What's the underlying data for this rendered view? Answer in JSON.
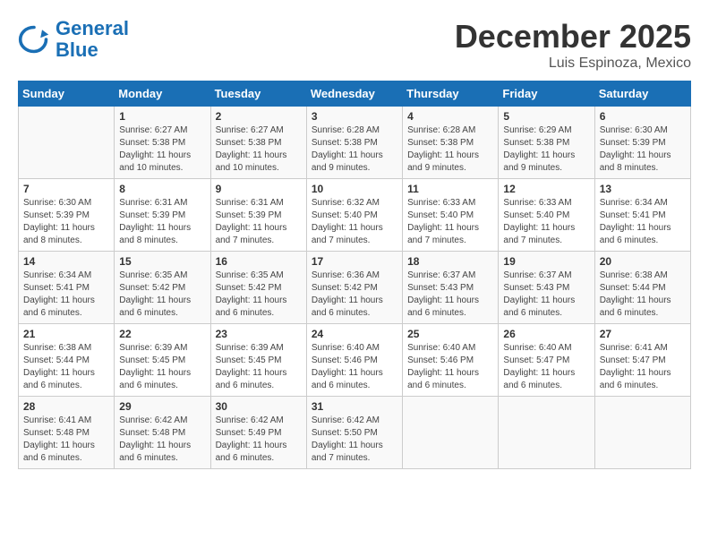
{
  "header": {
    "logo_line1": "General",
    "logo_line2": "Blue",
    "title": "December 2025",
    "subtitle": "Luis Espinoza, Mexico"
  },
  "columns": [
    "Sunday",
    "Monday",
    "Tuesday",
    "Wednesday",
    "Thursday",
    "Friday",
    "Saturday"
  ],
  "weeks": [
    [
      {
        "day": "",
        "text": ""
      },
      {
        "day": "1",
        "text": "Sunrise: 6:27 AM\nSunset: 5:38 PM\nDaylight: 11 hours and 10 minutes."
      },
      {
        "day": "2",
        "text": "Sunrise: 6:27 AM\nSunset: 5:38 PM\nDaylight: 11 hours and 10 minutes."
      },
      {
        "day": "3",
        "text": "Sunrise: 6:28 AM\nSunset: 5:38 PM\nDaylight: 11 hours and 9 minutes."
      },
      {
        "day": "4",
        "text": "Sunrise: 6:28 AM\nSunset: 5:38 PM\nDaylight: 11 hours and 9 minutes."
      },
      {
        "day": "5",
        "text": "Sunrise: 6:29 AM\nSunset: 5:38 PM\nDaylight: 11 hours and 9 minutes."
      },
      {
        "day": "6",
        "text": "Sunrise: 6:30 AM\nSunset: 5:39 PM\nDaylight: 11 hours and 8 minutes."
      }
    ],
    [
      {
        "day": "7",
        "text": "Sunrise: 6:30 AM\nSunset: 5:39 PM\nDaylight: 11 hours and 8 minutes."
      },
      {
        "day": "8",
        "text": "Sunrise: 6:31 AM\nSunset: 5:39 PM\nDaylight: 11 hours and 8 minutes."
      },
      {
        "day": "9",
        "text": "Sunrise: 6:31 AM\nSunset: 5:39 PM\nDaylight: 11 hours and 7 minutes."
      },
      {
        "day": "10",
        "text": "Sunrise: 6:32 AM\nSunset: 5:40 PM\nDaylight: 11 hours and 7 minutes."
      },
      {
        "day": "11",
        "text": "Sunrise: 6:33 AM\nSunset: 5:40 PM\nDaylight: 11 hours and 7 minutes."
      },
      {
        "day": "12",
        "text": "Sunrise: 6:33 AM\nSunset: 5:40 PM\nDaylight: 11 hours and 7 minutes."
      },
      {
        "day": "13",
        "text": "Sunrise: 6:34 AM\nSunset: 5:41 PM\nDaylight: 11 hours and 6 minutes."
      }
    ],
    [
      {
        "day": "14",
        "text": "Sunrise: 6:34 AM\nSunset: 5:41 PM\nDaylight: 11 hours and 6 minutes."
      },
      {
        "day": "15",
        "text": "Sunrise: 6:35 AM\nSunset: 5:42 PM\nDaylight: 11 hours and 6 minutes."
      },
      {
        "day": "16",
        "text": "Sunrise: 6:35 AM\nSunset: 5:42 PM\nDaylight: 11 hours and 6 minutes."
      },
      {
        "day": "17",
        "text": "Sunrise: 6:36 AM\nSunset: 5:42 PM\nDaylight: 11 hours and 6 minutes."
      },
      {
        "day": "18",
        "text": "Sunrise: 6:37 AM\nSunset: 5:43 PM\nDaylight: 11 hours and 6 minutes."
      },
      {
        "day": "19",
        "text": "Sunrise: 6:37 AM\nSunset: 5:43 PM\nDaylight: 11 hours and 6 minutes."
      },
      {
        "day": "20",
        "text": "Sunrise: 6:38 AM\nSunset: 5:44 PM\nDaylight: 11 hours and 6 minutes."
      }
    ],
    [
      {
        "day": "21",
        "text": "Sunrise: 6:38 AM\nSunset: 5:44 PM\nDaylight: 11 hours and 6 minutes."
      },
      {
        "day": "22",
        "text": "Sunrise: 6:39 AM\nSunset: 5:45 PM\nDaylight: 11 hours and 6 minutes."
      },
      {
        "day": "23",
        "text": "Sunrise: 6:39 AM\nSunset: 5:45 PM\nDaylight: 11 hours and 6 minutes."
      },
      {
        "day": "24",
        "text": "Sunrise: 6:40 AM\nSunset: 5:46 PM\nDaylight: 11 hours and 6 minutes."
      },
      {
        "day": "25",
        "text": "Sunrise: 6:40 AM\nSunset: 5:46 PM\nDaylight: 11 hours and 6 minutes."
      },
      {
        "day": "26",
        "text": "Sunrise: 6:40 AM\nSunset: 5:47 PM\nDaylight: 11 hours and 6 minutes."
      },
      {
        "day": "27",
        "text": "Sunrise: 6:41 AM\nSunset: 5:47 PM\nDaylight: 11 hours and 6 minutes."
      }
    ],
    [
      {
        "day": "28",
        "text": "Sunrise: 6:41 AM\nSunset: 5:48 PM\nDaylight: 11 hours and 6 minutes."
      },
      {
        "day": "29",
        "text": "Sunrise: 6:42 AM\nSunset: 5:48 PM\nDaylight: 11 hours and 6 minutes."
      },
      {
        "day": "30",
        "text": "Sunrise: 6:42 AM\nSunset: 5:49 PM\nDaylight: 11 hours and 6 minutes."
      },
      {
        "day": "31",
        "text": "Sunrise: 6:42 AM\nSunset: 5:50 PM\nDaylight: 11 hours and 7 minutes."
      },
      {
        "day": "",
        "text": ""
      },
      {
        "day": "",
        "text": ""
      },
      {
        "day": "",
        "text": ""
      }
    ]
  ]
}
